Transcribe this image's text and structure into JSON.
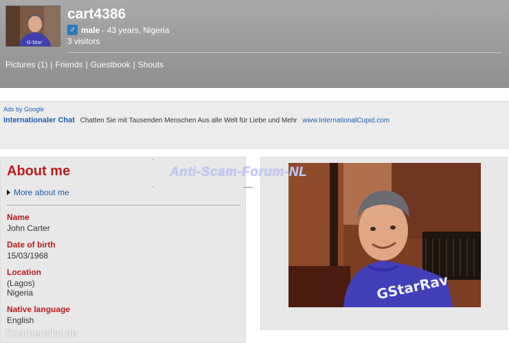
{
  "profile": {
    "username": "cart4386",
    "gender": "male",
    "details": " - 43 years, Nigeria",
    "visitors": "3 visitors"
  },
  "nav": {
    "pictures": "Pictures (1)",
    "friends": "Friends",
    "guestbook": "Guestbook",
    "shouts": "Shouts",
    "separator": "|"
  },
  "ads": {
    "by_google": "Ads by Google",
    "title": "Internationaler Chat",
    "text": "Chatten Sie mit Tausenden Menschen  Aus alle Welt für Liebe und Mehr",
    "url": "www.InternationalCupid.com"
  },
  "about": {
    "title": "About me",
    "more_link": "More about me",
    "fields": [
      {
        "label": "Name",
        "value": "John Carter"
      },
      {
        "label": "Date of birth",
        "value": "15/03/1968"
      },
      {
        "label": "Location",
        "value": "(Lagos)",
        "value2": "Nigeria"
      },
      {
        "label": "Native language",
        "value": "English"
      }
    ]
  },
  "watermarks": {
    "forum": "Anti-Scam-Forum-NL",
    "site": "Scamerslist.de"
  },
  "colors": {
    "header": "#999999",
    "accent_red": "#b81c1c",
    "link_blue": "#1a5fb4",
    "gender_icon": "#2a7ab8"
  }
}
